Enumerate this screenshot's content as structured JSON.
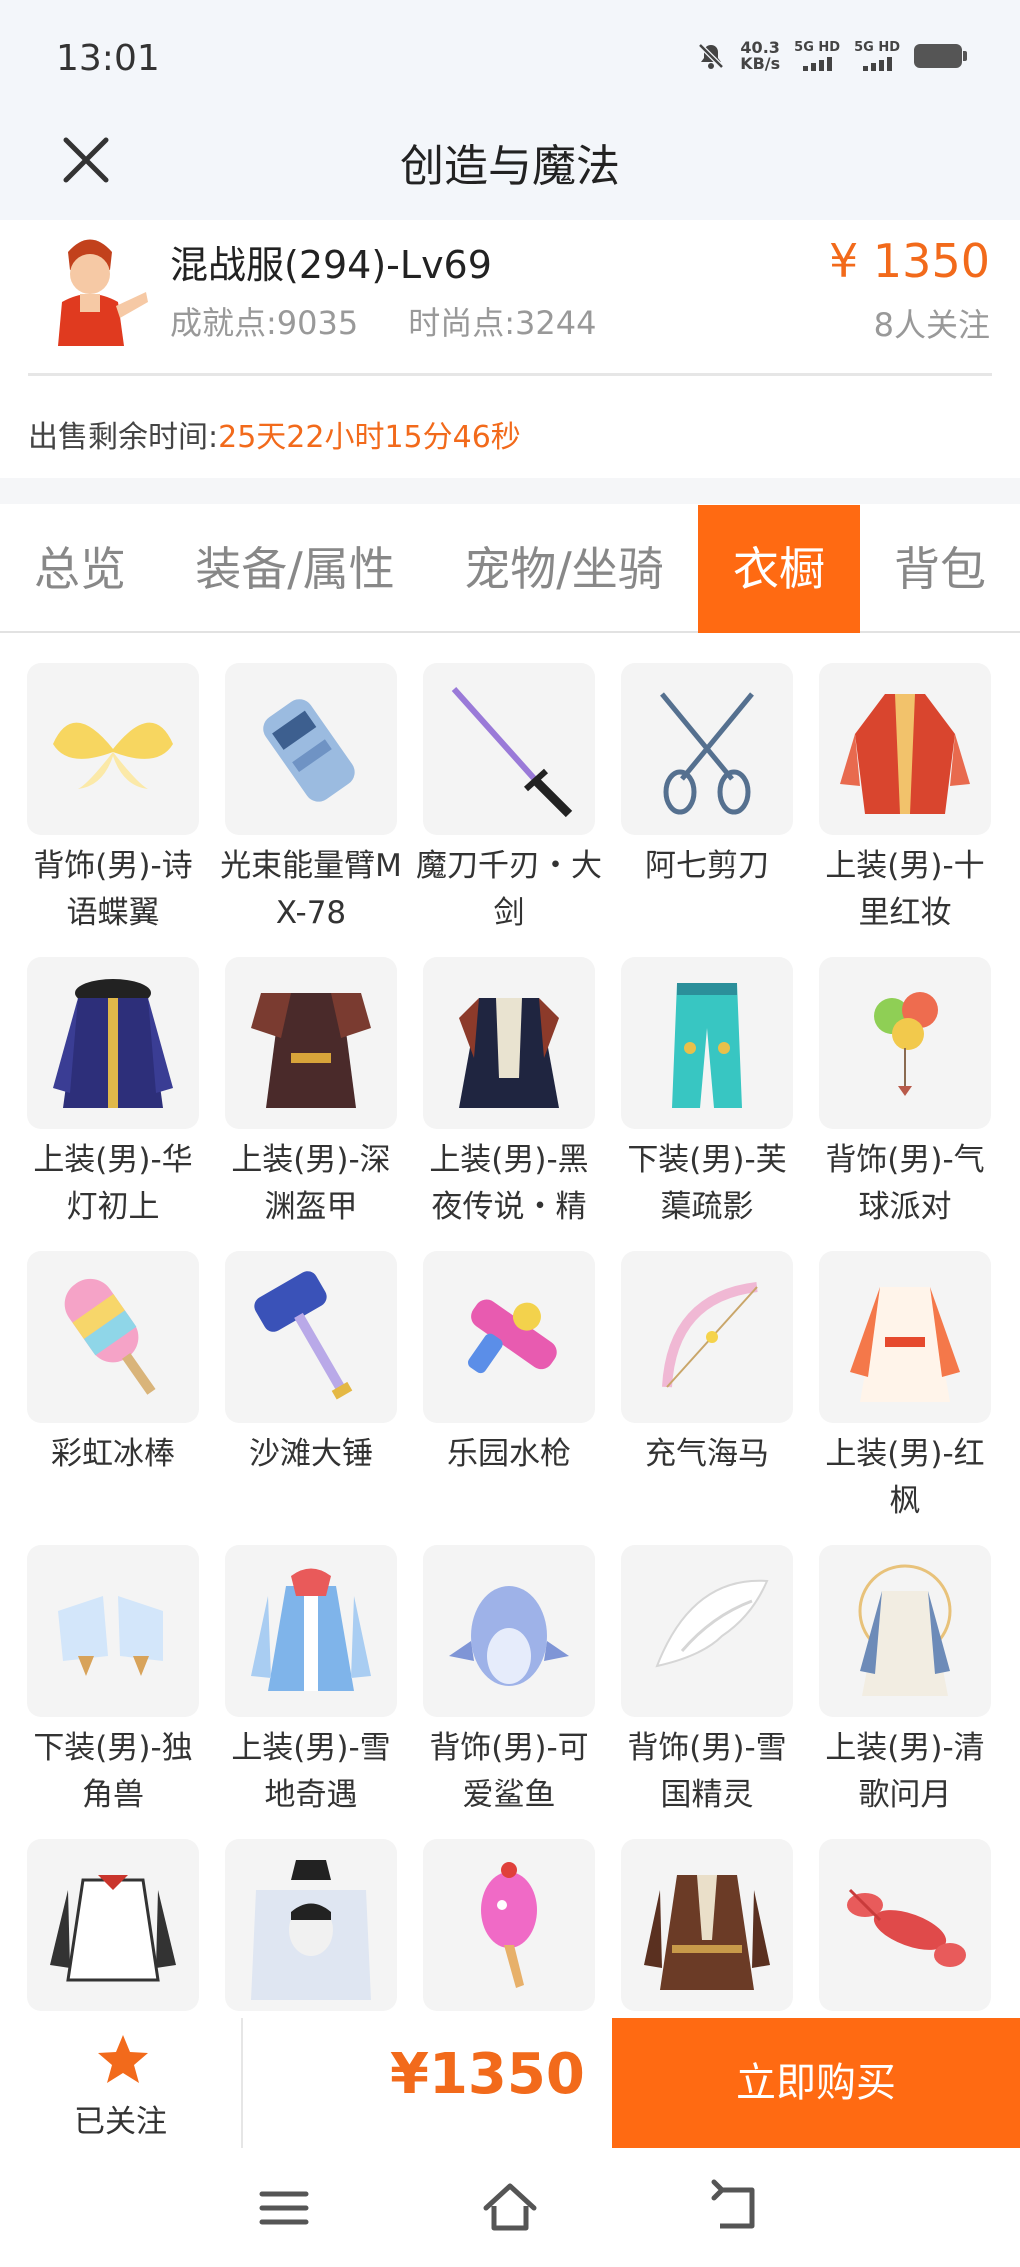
{
  "status_bar": {
    "time": "13:01",
    "net_speed_value": "40.3",
    "net_speed_unit": "KB/s",
    "sim1": "5G HD",
    "sim2": "5G HD"
  },
  "nav": {
    "title": "创造与魔法",
    "close_icon": "close-icon"
  },
  "account": {
    "name": "混战服(294)-Lv69",
    "achievement": "成就点:9035",
    "fashion": "时尚点:3244",
    "price": "¥ 1350",
    "followers": "8人关注",
    "sale_label": "出售剩余时间:",
    "sale_remaining": "25天22小时15分46秒"
  },
  "tabs": [
    {
      "label": "总览",
      "active": false
    },
    {
      "label": "装备/属性",
      "active": false
    },
    {
      "label": "宠物/坐骑",
      "active": false
    },
    {
      "label": "衣橱",
      "active": true
    },
    {
      "label": "背包",
      "active": false
    }
  ],
  "items": [
    {
      "name": "背饰(男)-诗语蝶翼",
      "icon": "butterfly-wings-icon"
    },
    {
      "name": "光束能量臂MX-78",
      "icon": "beam-arm-icon"
    },
    {
      "name": "魔刀千刃・大剑",
      "icon": "sword-icon"
    },
    {
      "name": "阿七剪刀",
      "icon": "scissors-icon"
    },
    {
      "name": "上装(男)-十里红妆",
      "icon": "red-robe-icon"
    },
    {
      "name": "上装(男)-华灯初上",
      "icon": "blue-coat-icon"
    },
    {
      "name": "上装(男)-深渊盔甲",
      "icon": "armor-icon"
    },
    {
      "name": "上装(男)-黑夜传说・精",
      "icon": "dark-coat-icon"
    },
    {
      "name": "下装(男)-芙蕖疏影",
      "icon": "teal-pants-icon"
    },
    {
      "name": "背饰(男)-气球派对",
      "icon": "balloons-icon"
    },
    {
      "name": "彩虹冰棒",
      "icon": "popsicle-icon"
    },
    {
      "name": "沙滩大锤",
      "icon": "hammer-icon"
    },
    {
      "name": "乐园水枪",
      "icon": "water-gun-icon"
    },
    {
      "name": "充气海马",
      "icon": "bow-icon"
    },
    {
      "name": "上装(男)-红枫",
      "icon": "maple-robe-icon"
    },
    {
      "name": "下装(男)-独角兽",
      "icon": "unicorn-boots-icon"
    },
    {
      "name": "上装(男)-雪地奇遇",
      "icon": "snow-coat-icon"
    },
    {
      "name": "背饰(男)-可爱鲨鱼",
      "icon": "shark-icon"
    },
    {
      "name": "背饰(男)-雪国精灵",
      "icon": "white-wing-icon"
    },
    {
      "name": "上装(男)-清歌问月",
      "icon": "moon-robe-icon"
    },
    {
      "name": "",
      "icon": "bomber-jacket-icon"
    },
    {
      "name": "",
      "icon": "crown-head-icon"
    },
    {
      "name": "",
      "icon": "pink-creature-icon"
    },
    {
      "name": "",
      "icon": "brown-coat-icon"
    },
    {
      "name": "",
      "icon": "lobster-icon"
    }
  ],
  "bottom_bar": {
    "follow_label": "已关注",
    "price": "¥1350",
    "buy_label": "立即购买"
  },
  "colors": {
    "accent": "#ff6a12",
    "price": "#f26a1b"
  }
}
